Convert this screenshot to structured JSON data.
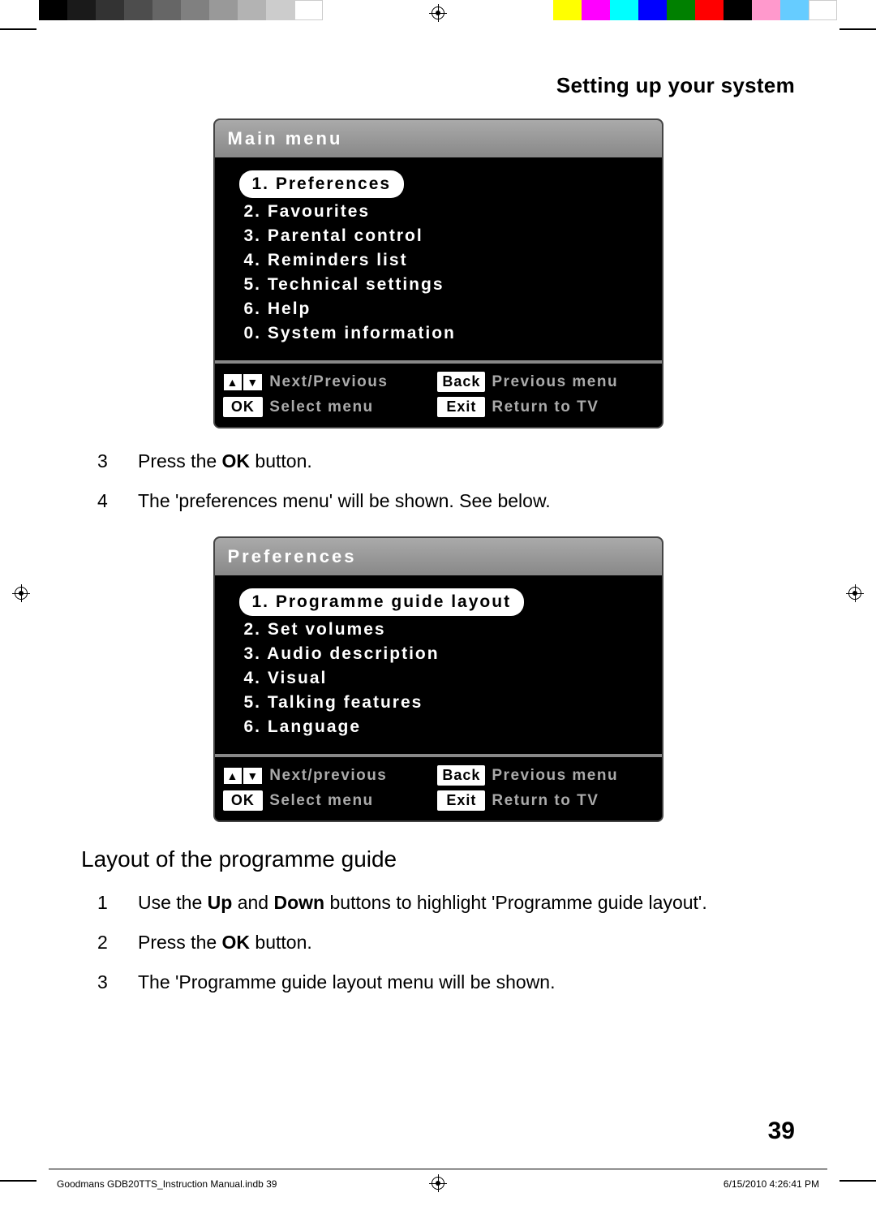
{
  "section_title": "Setting up your system",
  "main_menu": {
    "title": "Main menu",
    "items": [
      "1. Preferences",
      "2. Favourites",
      "3. Parental control",
      "4. Reminders list",
      "5. Technical settings",
      "6. Help",
      "0. System information"
    ],
    "footer": {
      "arrows_label": "Next/Previous",
      "back_key": "Back",
      "back_label": "Previous menu",
      "ok_key": "OK",
      "ok_label": "Select menu",
      "exit_key": "Exit",
      "exit_label": "Return to TV"
    }
  },
  "instructions_a": [
    {
      "num": "3",
      "html": "Press the <b>OK</b> button."
    },
    {
      "num": "4",
      "html": "The 'preferences menu' will be shown. See below."
    }
  ],
  "prefs_menu": {
    "title": "Preferences",
    "items": [
      "1. Programme guide layout",
      "2. Set volumes",
      "3. Audio description",
      "4. Visual",
      "5. Talking features",
      "6. Language"
    ],
    "footer": {
      "arrows_label": "Next/previous",
      "back_key": "Back",
      "back_label": "Previous menu",
      "ok_key": "OK",
      "ok_label": "Select menu",
      "exit_key": "Exit",
      "exit_label": "Return to TV"
    }
  },
  "subheading": "Layout of the programme guide",
  "instructions_b": [
    {
      "num": "1",
      "html": "Use the <b>Up</b> and <b>Down</b> buttons to highlight 'Programme guide layout'."
    },
    {
      "num": "2",
      "html": "Press the <b>OK</b> button."
    },
    {
      "num": "3",
      "html": "The 'Programme guide layout menu will be shown."
    }
  ],
  "page_number": "39",
  "footer": {
    "filename": "Goodmans GDB20TTS_Instruction Manual.indb   39",
    "timestamp": "6/15/2010   4:26:41 PM"
  },
  "bw_swatches": [
    "#000000",
    "#1a1a1a",
    "#333333",
    "#4d4d4d",
    "#666666",
    "#808080",
    "#999999",
    "#b3b3b3",
    "#cccccc",
    "#ffffff"
  ],
  "color_swatches": [
    "#ffff00",
    "#ff00ff",
    "#00ffff",
    "#0000ff",
    "#008000",
    "#ff0000",
    "#000000",
    "#ff99cc",
    "#66ccff",
    "#ffffff"
  ]
}
